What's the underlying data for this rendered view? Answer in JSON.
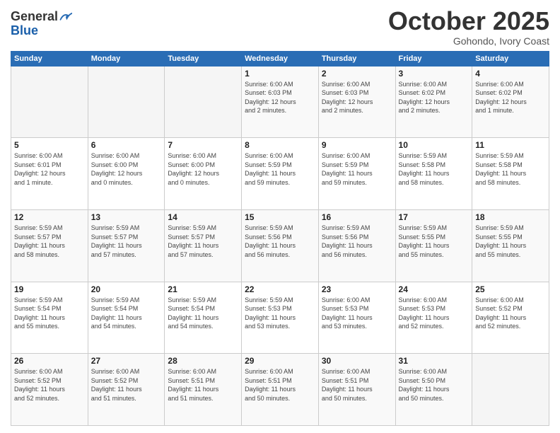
{
  "header": {
    "logo_general": "General",
    "logo_blue": "Blue",
    "month": "October 2025",
    "location": "Gohondo, Ivory Coast"
  },
  "days_of_week": [
    "Sunday",
    "Monday",
    "Tuesday",
    "Wednesday",
    "Thursday",
    "Friday",
    "Saturday"
  ],
  "weeks": [
    [
      {
        "day": "",
        "info": ""
      },
      {
        "day": "",
        "info": ""
      },
      {
        "day": "",
        "info": ""
      },
      {
        "day": "1",
        "info": "Sunrise: 6:00 AM\nSunset: 6:03 PM\nDaylight: 12 hours\nand 2 minutes."
      },
      {
        "day": "2",
        "info": "Sunrise: 6:00 AM\nSunset: 6:03 PM\nDaylight: 12 hours\nand 2 minutes."
      },
      {
        "day": "3",
        "info": "Sunrise: 6:00 AM\nSunset: 6:02 PM\nDaylight: 12 hours\nand 2 minutes."
      },
      {
        "day": "4",
        "info": "Sunrise: 6:00 AM\nSunset: 6:02 PM\nDaylight: 12 hours\nand 1 minute."
      }
    ],
    [
      {
        "day": "5",
        "info": "Sunrise: 6:00 AM\nSunset: 6:01 PM\nDaylight: 12 hours\nand 1 minute."
      },
      {
        "day": "6",
        "info": "Sunrise: 6:00 AM\nSunset: 6:00 PM\nDaylight: 12 hours\nand 0 minutes."
      },
      {
        "day": "7",
        "info": "Sunrise: 6:00 AM\nSunset: 6:00 PM\nDaylight: 12 hours\nand 0 minutes."
      },
      {
        "day": "8",
        "info": "Sunrise: 6:00 AM\nSunset: 5:59 PM\nDaylight: 11 hours\nand 59 minutes."
      },
      {
        "day": "9",
        "info": "Sunrise: 6:00 AM\nSunset: 5:59 PM\nDaylight: 11 hours\nand 59 minutes."
      },
      {
        "day": "10",
        "info": "Sunrise: 5:59 AM\nSunset: 5:58 PM\nDaylight: 11 hours\nand 58 minutes."
      },
      {
        "day": "11",
        "info": "Sunrise: 5:59 AM\nSunset: 5:58 PM\nDaylight: 11 hours\nand 58 minutes."
      }
    ],
    [
      {
        "day": "12",
        "info": "Sunrise: 5:59 AM\nSunset: 5:57 PM\nDaylight: 11 hours\nand 58 minutes."
      },
      {
        "day": "13",
        "info": "Sunrise: 5:59 AM\nSunset: 5:57 PM\nDaylight: 11 hours\nand 57 minutes."
      },
      {
        "day": "14",
        "info": "Sunrise: 5:59 AM\nSunset: 5:57 PM\nDaylight: 11 hours\nand 57 minutes."
      },
      {
        "day": "15",
        "info": "Sunrise: 5:59 AM\nSunset: 5:56 PM\nDaylight: 11 hours\nand 56 minutes."
      },
      {
        "day": "16",
        "info": "Sunrise: 5:59 AM\nSunset: 5:56 PM\nDaylight: 11 hours\nand 56 minutes."
      },
      {
        "day": "17",
        "info": "Sunrise: 5:59 AM\nSunset: 5:55 PM\nDaylight: 11 hours\nand 55 minutes."
      },
      {
        "day": "18",
        "info": "Sunrise: 5:59 AM\nSunset: 5:55 PM\nDaylight: 11 hours\nand 55 minutes."
      }
    ],
    [
      {
        "day": "19",
        "info": "Sunrise: 5:59 AM\nSunset: 5:54 PM\nDaylight: 11 hours\nand 55 minutes."
      },
      {
        "day": "20",
        "info": "Sunrise: 5:59 AM\nSunset: 5:54 PM\nDaylight: 11 hours\nand 54 minutes."
      },
      {
        "day": "21",
        "info": "Sunrise: 5:59 AM\nSunset: 5:54 PM\nDaylight: 11 hours\nand 54 minutes."
      },
      {
        "day": "22",
        "info": "Sunrise: 5:59 AM\nSunset: 5:53 PM\nDaylight: 11 hours\nand 53 minutes."
      },
      {
        "day": "23",
        "info": "Sunrise: 6:00 AM\nSunset: 5:53 PM\nDaylight: 11 hours\nand 53 minutes."
      },
      {
        "day": "24",
        "info": "Sunrise: 6:00 AM\nSunset: 5:53 PM\nDaylight: 11 hours\nand 52 minutes."
      },
      {
        "day": "25",
        "info": "Sunrise: 6:00 AM\nSunset: 5:52 PM\nDaylight: 11 hours\nand 52 minutes."
      }
    ],
    [
      {
        "day": "26",
        "info": "Sunrise: 6:00 AM\nSunset: 5:52 PM\nDaylight: 11 hours\nand 52 minutes."
      },
      {
        "day": "27",
        "info": "Sunrise: 6:00 AM\nSunset: 5:52 PM\nDaylight: 11 hours\nand 51 minutes."
      },
      {
        "day": "28",
        "info": "Sunrise: 6:00 AM\nSunset: 5:51 PM\nDaylight: 11 hours\nand 51 minutes."
      },
      {
        "day": "29",
        "info": "Sunrise: 6:00 AM\nSunset: 5:51 PM\nDaylight: 11 hours\nand 50 minutes."
      },
      {
        "day": "30",
        "info": "Sunrise: 6:00 AM\nSunset: 5:51 PM\nDaylight: 11 hours\nand 50 minutes."
      },
      {
        "day": "31",
        "info": "Sunrise: 6:00 AM\nSunset: 5:50 PM\nDaylight: 11 hours\nand 50 minutes."
      },
      {
        "day": "",
        "info": ""
      }
    ]
  ]
}
